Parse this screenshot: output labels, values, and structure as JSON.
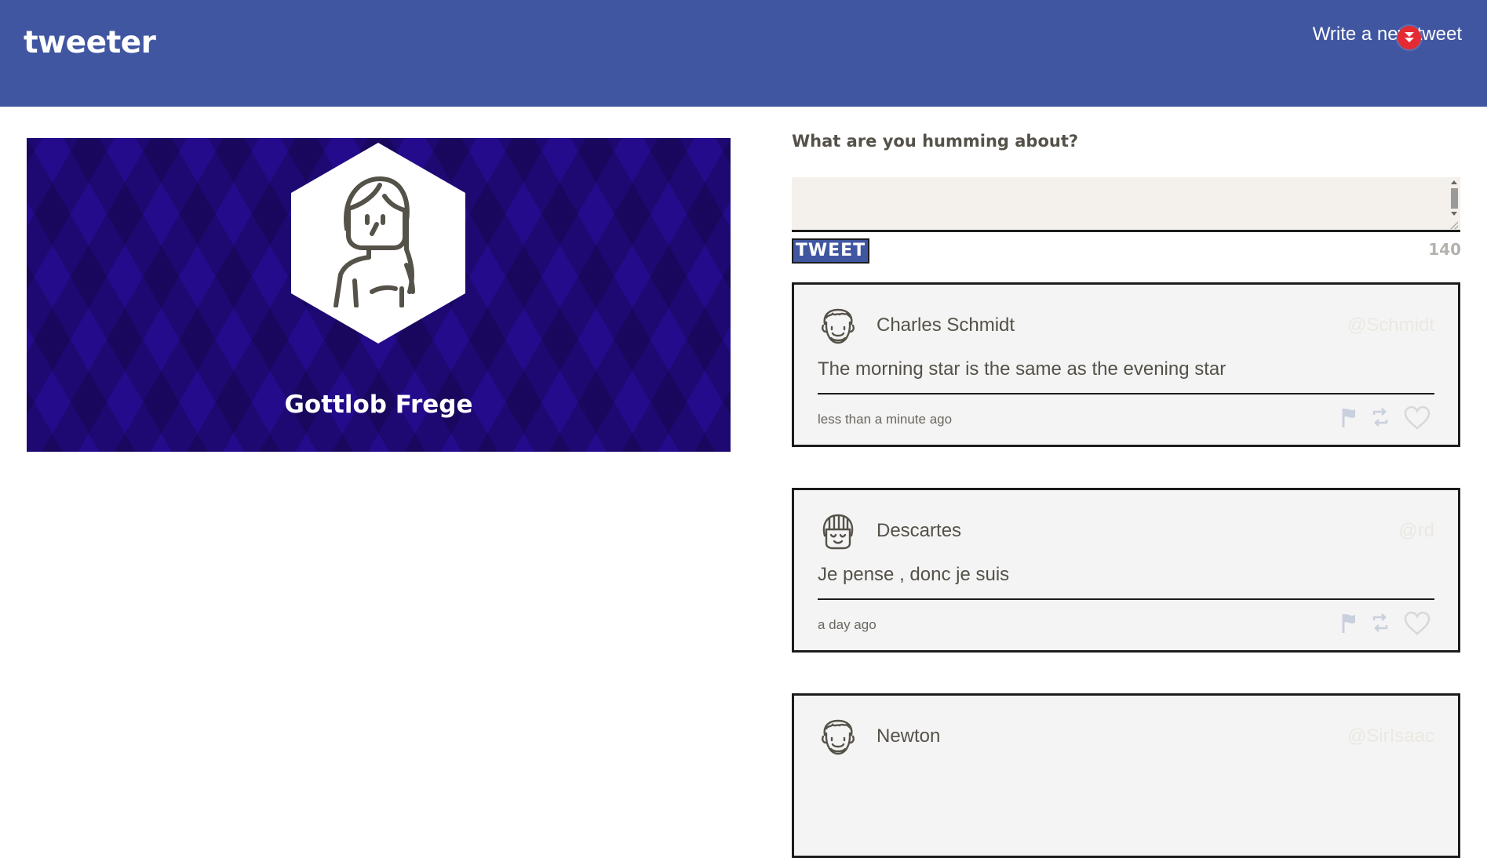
{
  "header": {
    "brand": "tweeter",
    "compose_toggle_label": "Write a new tweet",
    "compose_toggle_icon": "double-chevron-down-icon",
    "background_color": "#4056A1",
    "badge_color": "#e42b33"
  },
  "profile": {
    "name": "Gottlob Frege",
    "avatar_icon": "avatar-woman-icon",
    "banner_color": "#240b8c"
  },
  "compose": {
    "prompt": "What are you humming about?",
    "textarea_value": "",
    "button_label": "TWEET",
    "char_count": "140"
  },
  "tweets": [
    {
      "author": "Charles Schmidt",
      "handle": "@Schmidt",
      "text": "The morning star is the same as the evening star",
      "timestamp": "less than a minute ago",
      "avatar_icon": "avatar-curly-man-icon"
    },
    {
      "author": "Descartes",
      "handle": "@rd",
      "text": "Je pense , donc je suis",
      "timestamp": "a day ago",
      "avatar_icon": "avatar-bangs-icon"
    },
    {
      "author": "Newton",
      "handle": "@SirIsaac",
      "text": "",
      "timestamp": "",
      "avatar_icon": "avatar-curly-man-icon"
    }
  ],
  "tweet_actions": [
    "flag-icon",
    "retweet-icon",
    "heart-icon"
  ]
}
